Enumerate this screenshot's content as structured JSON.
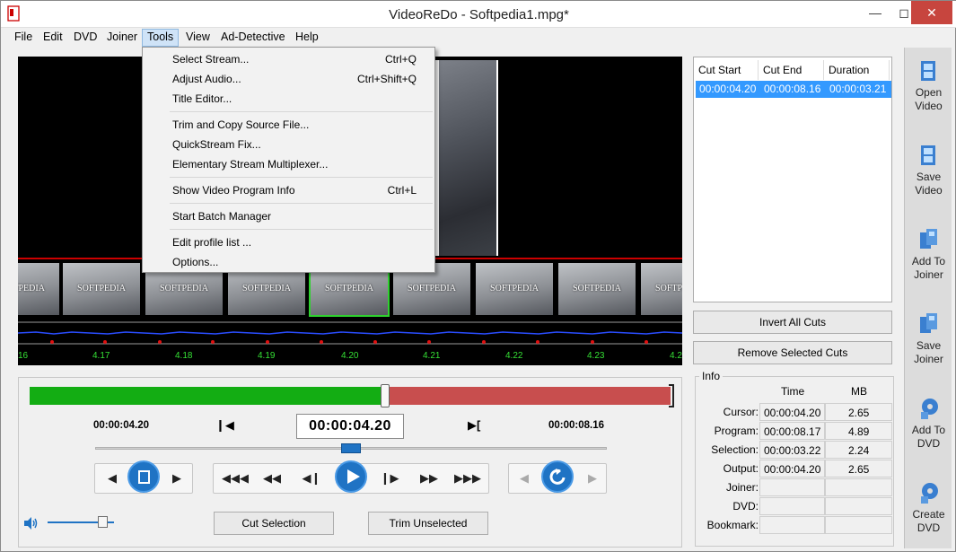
{
  "window": {
    "title": "VideoReDo - Softpedia1.mpg*"
  },
  "menu": {
    "items": [
      "File",
      "Edit",
      "DVD",
      "Joiner",
      "Tools",
      "View",
      "Ad-Detective",
      "Help"
    ]
  },
  "tools_menu": {
    "items": [
      {
        "label": "Select Stream...",
        "shortcut": "Ctrl+Q"
      },
      {
        "label": "Adjust Audio...",
        "shortcut": "Ctrl+Shift+Q"
      },
      {
        "label": "Title Editor...",
        "shortcut": ""
      },
      {
        "label": "Trim and Copy Source File...",
        "shortcut": ""
      },
      {
        "label": "QuickStream Fix...",
        "shortcut": ""
      },
      {
        "label": "Elementary Stream Multiplexer...",
        "shortcut": ""
      },
      {
        "label": "Show Video Program Info",
        "shortcut": "Ctrl+L"
      },
      {
        "label": "Start Batch Manager",
        "shortcut": ""
      },
      {
        "label": "Edit profile list ...",
        "shortcut": ""
      },
      {
        "label": "Options...",
        "shortcut": ""
      }
    ]
  },
  "filmstrip": {
    "thumb_label": "SOFTPEDIA"
  },
  "timeline": {
    "labels": [
      "16",
      "4.17",
      "4.18",
      "4.19",
      "4.20",
      "4.21",
      "4.22",
      "4.23",
      "4.2"
    ]
  },
  "transport": {
    "start_time": "00:00:04.20",
    "current_time": "00:00:04.20",
    "end_time": "00:00:08.16",
    "position_fraction": 0.5,
    "volume_fraction": 0.83,
    "cut_selection": "Cut Selection",
    "trim_unselected": "Trim Unselected"
  },
  "cuts_table": {
    "headers": [
      "Cut Start",
      "Cut End",
      "Duration"
    ],
    "rows": [
      [
        "00:00:04.20",
        "00:00:08.16",
        "00:00:03.21"
      ]
    ]
  },
  "cut_buttons": {
    "invert": "Invert All Cuts",
    "remove": "Remove Selected Cuts"
  },
  "info": {
    "title": "Info",
    "col_time": "Time",
    "col_mb": "MB",
    "rows": [
      {
        "label": "Cursor:",
        "time": "00:00:04.20",
        "mb": "2.65"
      },
      {
        "label": "Program:",
        "time": "00:00:08.17",
        "mb": "4.89"
      },
      {
        "label": "Selection:",
        "time": "00:00:03.22",
        "mb": "2.24"
      },
      {
        "label": "Output:",
        "time": "00:00:04.20",
        "mb": "2.65"
      },
      {
        "label": "Joiner:",
        "time": "",
        "mb": ""
      },
      {
        "label": "DVD:",
        "time": "",
        "mb": ""
      },
      {
        "label": "Bookmark:",
        "time": "",
        "mb": ""
      }
    ]
  },
  "sidebar": {
    "open_video": [
      "Open",
      "Video"
    ],
    "save_video": [
      "Save",
      "Video"
    ],
    "add_to_joiner": [
      "Add To",
      "Joiner"
    ],
    "save_joiner": [
      "Save",
      "Joiner"
    ],
    "add_to_dvd": [
      "Add To",
      "DVD"
    ],
    "create_dvd": [
      "Create",
      "DVD"
    ]
  },
  "colors": {
    "accent": "#1f73c4",
    "selection": "#3399ff",
    "kept": "#13ad13",
    "cut": "#c84e4e"
  }
}
